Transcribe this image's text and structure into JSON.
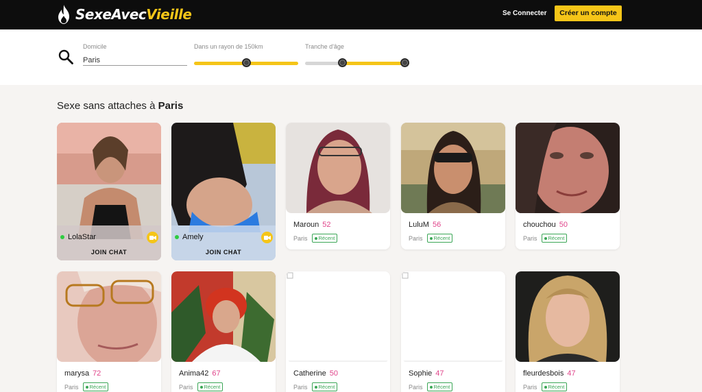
{
  "brand": {
    "name_part1": "SexeAvec",
    "name_part2": "Vieille",
    "accent": "#f5c518",
    "header_bg": "#0d0d0d"
  },
  "header": {
    "login_label": "Se Connecter",
    "signup_label": "Créer un compte"
  },
  "filters": {
    "domicile_label": "Domicile",
    "domicile_value": "Paris",
    "radius_label": "Dans un rayon de 150km",
    "radius_level_percent": 50,
    "age_label": "Tranche d'âge",
    "age_range_percent": [
      36,
      100
    ]
  },
  "section": {
    "title_prefix": "Sexe sans attaches à",
    "title_city": "Paris"
  },
  "live_cards": [
    {
      "name": "LolaStar",
      "action": "JOIN CHAT",
      "status": "online",
      "icon": "camera-icon"
    },
    {
      "name": "Amely",
      "action": "JOIN CHAT",
      "status": "online",
      "icon": "camera-icon"
    }
  ],
  "profiles_row1": [
    {
      "name": "Maroun",
      "age": "52",
      "city": "Paris",
      "badge": "Récent"
    },
    {
      "name": "LuluM",
      "age": "56",
      "city": "Paris",
      "badge": "Récent"
    },
    {
      "name": "chouchou",
      "age": "50",
      "city": "Paris",
      "badge": "Récent"
    }
  ],
  "profiles_row2": [
    {
      "name": "marysa",
      "age": "72",
      "city": "Paris",
      "badge": "Récent"
    },
    {
      "name": "Anima42",
      "age": "67",
      "city": "Paris",
      "badge": "Récent"
    },
    {
      "name": "Catherine",
      "age": "50",
      "city": "Paris",
      "badge": "Récent"
    },
    {
      "name": "Sophie",
      "age": "47",
      "city": "Paris",
      "badge": "Récent"
    },
    {
      "name": "fleurdesbois",
      "age": "47",
      "city": "Paris",
      "badge": "Récent"
    }
  ]
}
